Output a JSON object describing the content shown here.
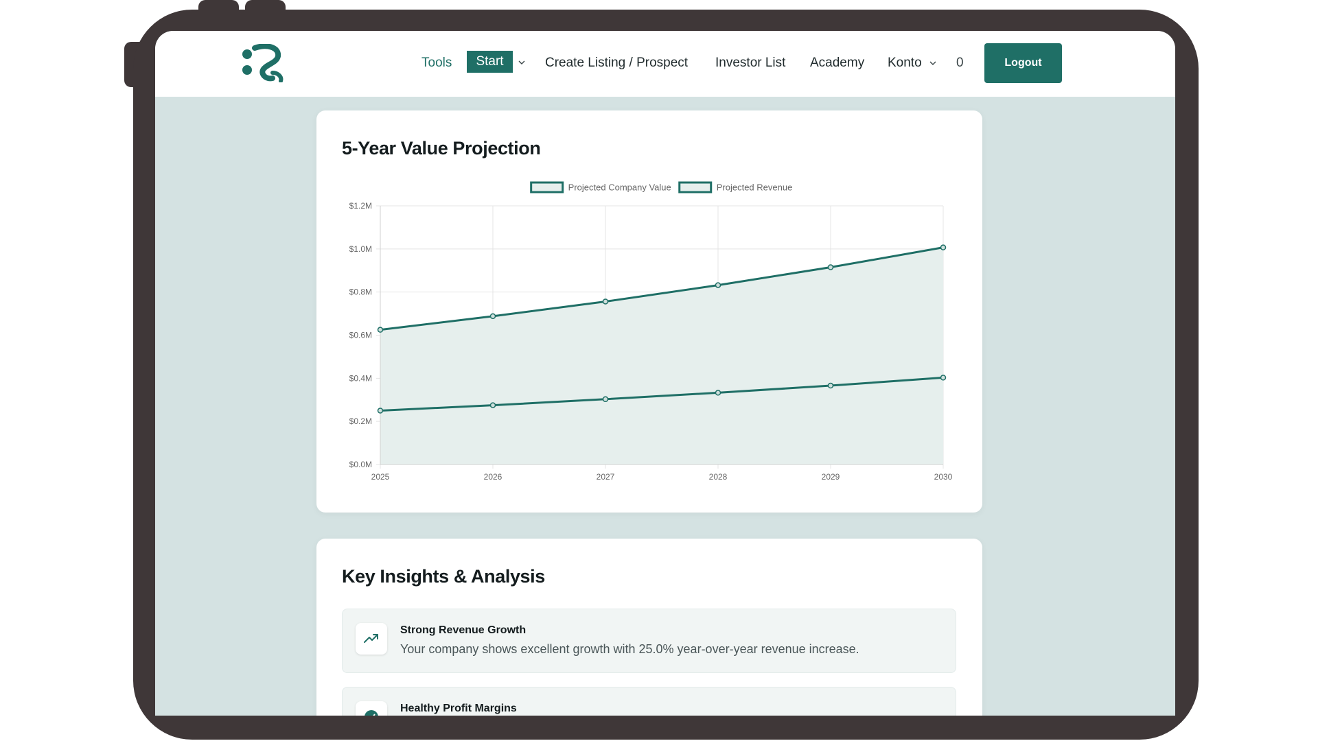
{
  "colors": {
    "brand": "#1f6f66",
    "frame": "#3f3738",
    "background": "#d4e2e2",
    "area_fill": "#e6efed"
  },
  "nav": {
    "tools": "Tools",
    "start": "Start",
    "create_listing": "Create Listing / Prospect",
    "investor_list": "Investor List",
    "academy": "Academy",
    "konto": "Konto",
    "count": "0",
    "logout": "Logout"
  },
  "projection": {
    "title": "5-Year Value Projection"
  },
  "chart_data": {
    "type": "line",
    "x": [
      "2025",
      "2026",
      "2027",
      "2028",
      "2029",
      "2030"
    ],
    "series": [
      {
        "name": "Projected Company Value",
        "values": [
          0.625,
          0.688,
          0.756,
          0.832,
          0.915,
          1.007
        ],
        "fill": true
      },
      {
        "name": "Projected Revenue",
        "values": [
          0.25,
          0.275,
          0.303,
          0.333,
          0.366,
          0.403
        ],
        "fill": true
      }
    ],
    "yticks": [
      "$0.0M",
      "$0.2M",
      "$0.4M",
      "$0.6M",
      "$0.8M",
      "$1.0M",
      "$1.2M"
    ],
    "ylim": [
      0,
      1.2
    ],
    "grid": true,
    "legend": "top-center"
  },
  "insights": {
    "title": "Key Insights & Analysis",
    "items": [
      {
        "title": "Strong Revenue Growth",
        "text": "Your company shows excellent growth with 25.0% year-over-year revenue increase.",
        "icon": "trending-up-icon"
      },
      {
        "title": "Healthy Profit Margins",
        "text": "",
        "icon": "check-circle-icon"
      }
    ]
  }
}
